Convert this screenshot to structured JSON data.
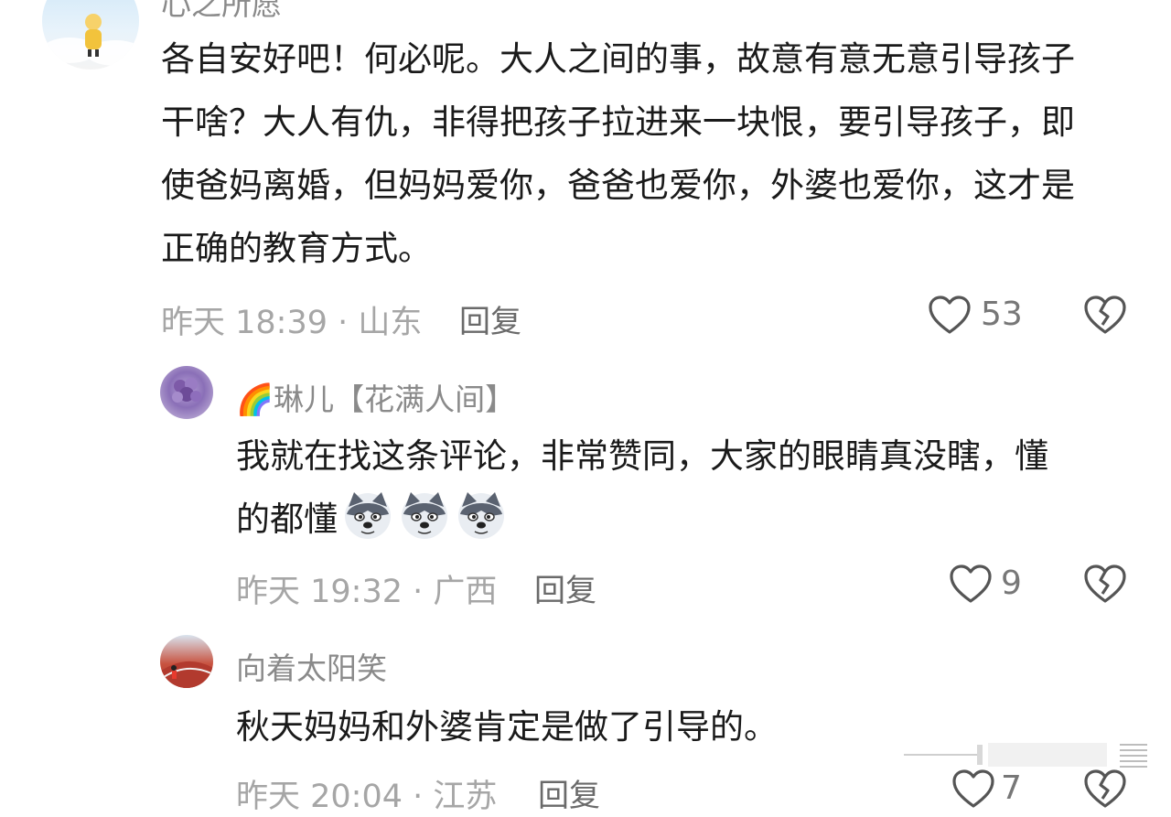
{
  "comments": [
    {
      "username": "心之所愿",
      "text": "各自安好吧！何必呢。大人之间的事，故意有意无意引导孩子干啥？大人有仇，非得把孩子拉进来一块恨，要引导孩子，即使爸妈离婚，但妈妈爱你，爸爸也爱你，外婆也爱你，这才是正确的教育方式。",
      "time_location": "昨天 18:39 · 山东",
      "reply_label": "回复",
      "likes": "53"
    },
    {
      "username": "🌈琳儿【花满人间】",
      "text": "我就在找这条评论，非常赞同，大家的眼睛真没瞎，懂的都懂",
      "time_location": "昨天 19:32 · 广西",
      "reply_label": "回复",
      "likes": "9"
    },
    {
      "username": "向着太阳笑",
      "text": "秋天妈妈和外婆肯定是做了引导的。",
      "time_location": "昨天 20:04 · 江苏",
      "reply_label": "回复",
      "likes": "7"
    }
  ],
  "icons": {
    "like": "heart-outline-icon",
    "dislike": "broken-heart-icon",
    "emoji": "wolf-emoji-icon"
  },
  "colors": {
    "text": "#1a1a1a",
    "meta": "#a6a6a6",
    "name": "#8a8a8a"
  }
}
